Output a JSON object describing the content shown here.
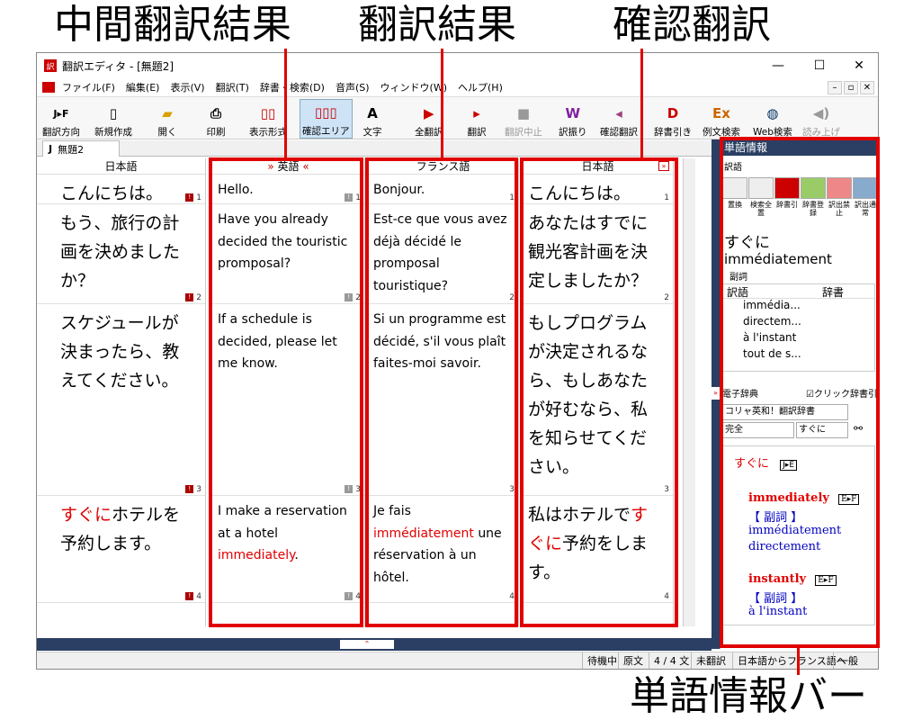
{
  "annotations": {
    "intermediate": "中間翻訳結果",
    "result": "翻訳結果",
    "confirm": "確認翻訳",
    "wordbar": "単語情報バー"
  },
  "window": {
    "title": "翻訳エディタ - [無題2]",
    "min": "—",
    "max": "☐",
    "close": "✕"
  },
  "menu": [
    "ファイル(F)",
    "編集(E)",
    "表示(V)",
    "翻訳(T)",
    "辞書・検索(D)",
    "音声(S)",
    "ウィンドウ(W)",
    "ヘルプ(H)"
  ],
  "toolbar": {
    "direction": "翻訳方向",
    "direction_icon": "J▸F",
    "new": "新規作成",
    "open": "開く",
    "print": "印刷",
    "display": "表示形式",
    "confirm_area": "確認エリア",
    "text": "文字",
    "translate_all": "全翻訳",
    "translate": "翻訳",
    "stop": "翻訳中止",
    "assign": "訳振り",
    "confirm_translate": "確認翻訳",
    "dict_lookup": "辞書引き",
    "example_search": "例文検索",
    "web_search": "Web検索",
    "read_aloud": "読み上げ"
  },
  "tab": {
    "label": "無題2",
    "prefix": "J"
  },
  "panes": {
    "source_header": "日本語",
    "inter_header": "英語",
    "target_header": "フランス語",
    "confirm_header": "日本語"
  },
  "segments": {
    "source": [
      "こんにちは。",
      "もう、旅行の計画を決めましたか？",
      "スケジュールが決まったら、教えてください。",
      "ホテルを予約します。"
    ],
    "source_red": "すぐに",
    "inter": [
      "Hello.",
      "Have you already decided the touristic promposal?",
      "If a schedule is decided, please let me know.",
      "I make a reservation at a hotel"
    ],
    "inter_red": "immediately",
    "inter_tail": ".",
    "target": [
      "Bonjour.",
      "Est-ce que vous avez déjà décidé le promposal touristique?",
      "Si un programme est décidé, s'il vous plaît faites-moi savoir.",
      "Je fais"
    ],
    "target_red": "immédiatement",
    "target_tail": "une réservation à un hôtel.",
    "confirm": [
      "こんにちは。",
      "あなたはすでに観光客計画を決定しましたか？",
      "もしプログラムが決定されるなら、もしあなたが好むなら、私を知らせてください。",
      "私はホテルで"
    ],
    "confirm_red": "すぐに",
    "confirm_tail": "予約をします。",
    "nums": [
      "1",
      "2",
      "3",
      "4"
    ]
  },
  "status": {
    "state": "待機中",
    "source": "原文",
    "count": "4 / 4 文",
    "untranslated": "未翻訳",
    "direction": "日本語からフランス語へ",
    "field": "一般"
  },
  "side": {
    "header": "単語情報",
    "sub": "訳語",
    "btns": [
      "置換",
      "検索全置",
      "辞書引",
      "辞書登録",
      "訳出禁止",
      "訳出通常"
    ],
    "word": "すぐに",
    "translation": "immédiatement",
    "pos": "副詞",
    "table_head": [
      "訳語",
      "辞書"
    ],
    "rows": [
      "immédia...",
      "directem...",
      "à l'instant",
      "tout de s..."
    ],
    "dict_label": "電子辞典",
    "click_dict": "クリック辞書引",
    "dict_select": "コリャ英和！翻訳辞書",
    "match_select": "完全",
    "query": "すぐに",
    "entry_word": "すぐに",
    "entry_tag": "J▸E",
    "sense1_word": "immediately",
    "sense_tag": "E▸F",
    "sense1_pos": "【 副詞 】",
    "sense1_t1": "immédiatement",
    "sense1_t2": "directement",
    "sense2_word": "instantly",
    "sense2_pos": "【 副詞 】",
    "sense2_t1": "à l'instant"
  }
}
